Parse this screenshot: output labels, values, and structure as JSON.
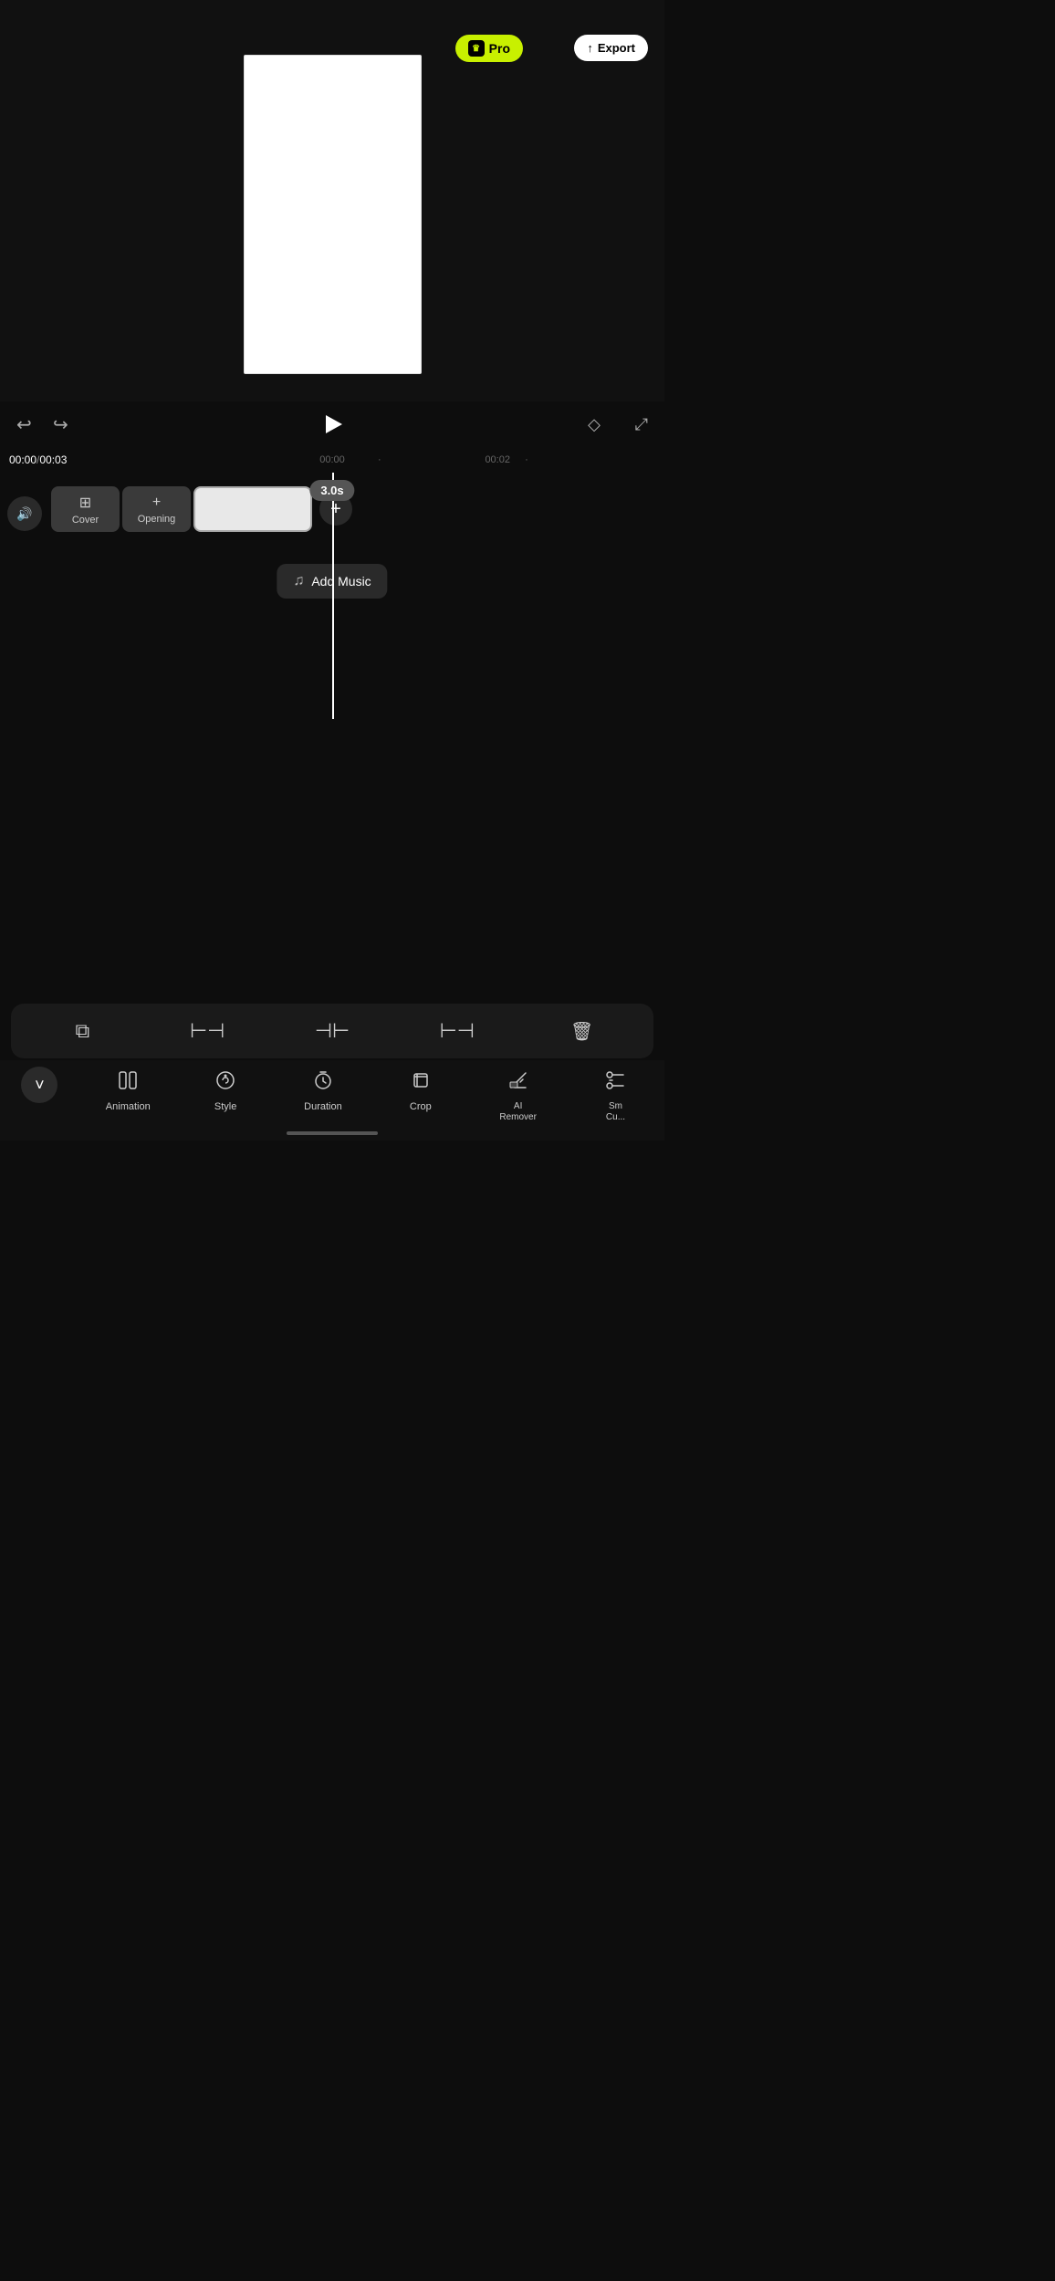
{
  "header": {
    "close_label": "✕",
    "pro_label": "Pro",
    "pro_crown": "♛",
    "export_label": "Export",
    "export_icon": "↑"
  },
  "controls": {
    "undo_icon": "↩",
    "redo_icon": "↪",
    "play_label": "Play",
    "magic_icon": "◇",
    "fullscreen_icon": "⤢"
  },
  "timeline": {
    "current_time": "00:00",
    "total_time": "00:03",
    "marker_center": "00:00",
    "marker_right": "00:02",
    "duration_tooltip": "3.0s",
    "volume_icon": "🔊",
    "cover_label": "Cover",
    "opening_label": "Opening",
    "add_music_label": "Add Music",
    "add_music_icon": "♫"
  },
  "bottom_toolbar": {
    "icons": [
      "⧉",
      "⊢⊣",
      "⊣⊢",
      "⊢⊣",
      "🗑"
    ]
  },
  "bottom_nav": {
    "chevron_icon": "˅",
    "items": [
      {
        "id": "animation",
        "icon": "▣",
        "label": "Animation"
      },
      {
        "id": "style",
        "icon": "☺",
        "label": "Style"
      },
      {
        "id": "duration",
        "icon": "⏱",
        "label": "Duration"
      },
      {
        "id": "crop",
        "icon": "⊡",
        "label": "Crop"
      },
      {
        "id": "ai-remover",
        "icon": "◈",
        "label": "AI\nRemover"
      },
      {
        "id": "smart-cut",
        "icon": "✂",
        "label": "Sm\nCu..."
      }
    ]
  }
}
